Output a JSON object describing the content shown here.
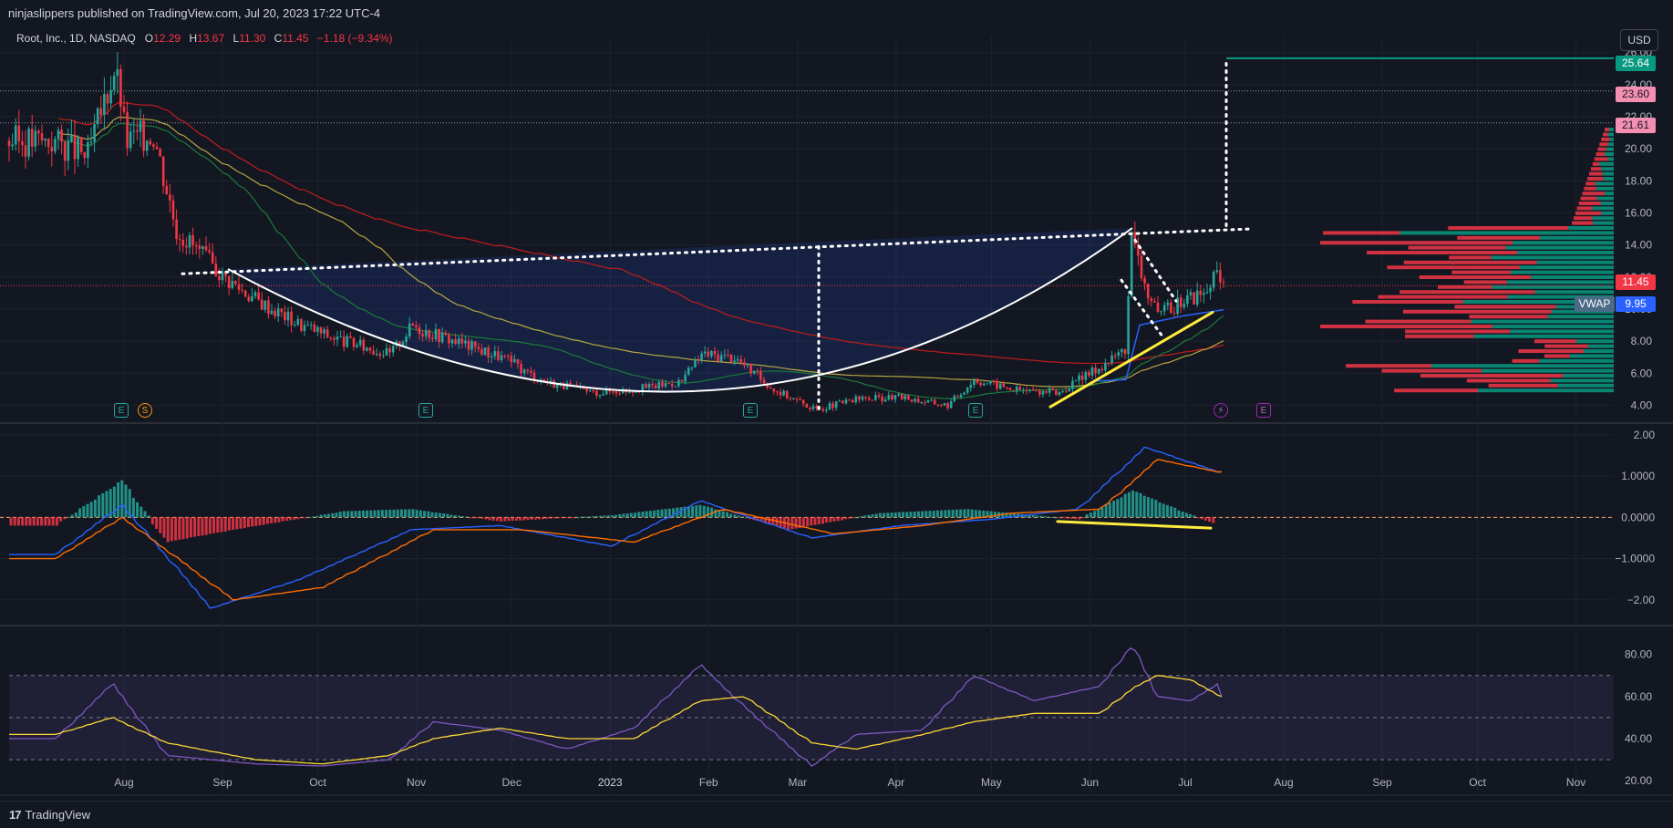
{
  "header": {
    "published": "ninjaslippers published on TradingView.com, Jul 20, 2023 17:22 UTC-4"
  },
  "legend": {
    "symbol": "Root, Inc., 1D, NASDAQ",
    "o_label": "O",
    "o": "12.29",
    "h_label": "H",
    "h": "13.67",
    "l_label": "L",
    "l": "11.30",
    "c_label": "C",
    "c": "11.45",
    "change": "−1.18 (−9.34%)"
  },
  "currency": "USD",
  "colors": {
    "bg": "#131722",
    "up": "#26a69a",
    "down": "#f23645",
    "grid": "#1e222d",
    "accent_green": "#089981",
    "pink": "#f7525f"
  },
  "price_tags": [
    {
      "label": "25.64",
      "color": "#089981"
    },
    {
      "label": "23.60",
      "color": "#f48fb1"
    },
    {
      "label": "21.61",
      "color": "#f48fb1"
    },
    {
      "label": "11.45",
      "color": "#f23645"
    },
    {
      "label": "9.95",
      "color": "#2962ff"
    }
  ],
  "vwap_label": "VWAP",
  "events": [
    "E",
    "S",
    "E",
    "E",
    "E",
    "⚡",
    "E"
  ],
  "footer": {
    "brand": "TradingView",
    "logo": "17"
  },
  "chart_data": [
    {
      "type": "line",
      "panel": "price",
      "y_axis_ticks": [
        "26.00",
        "24.00",
        "22.00",
        "20.00",
        "18.00",
        "16.00",
        "14.00",
        "12.00",
        "10.00",
        "8.00",
        "6.00",
        "4.00"
      ],
      "x_axis_ticks": [
        "Aug",
        "Sep",
        "Oct",
        "Nov",
        "Dec",
        "2023",
        "Feb",
        "Mar",
        "Apr",
        "May",
        "Jun",
        "Jul",
        "Aug",
        "Sep",
        "Oct",
        "Nov"
      ],
      "series": [
        {
          "x": [
            "2022-07-18",
            "2022-07-28",
            "2022-08-05",
            "2022-08-10",
            "2022-08-18",
            "2022-08-25",
            "2022-09-06",
            "2022-09-20",
            "2022-10-03",
            "2022-10-17",
            "2022-10-31",
            "2022-11-07",
            "2022-11-21",
            "2022-12-05",
            "2022-12-19",
            "2023-01-03",
            "2023-01-17",
            "2023-01-31",
            "2023-02-06",
            "2023-02-17",
            "2023-03-01",
            "2023-03-14",
            "2023-03-28",
            "2023-04-10",
            "2023-04-25",
            "2023-05-03",
            "2023-05-15",
            "2023-05-30",
            "2023-06-12",
            "2023-06-20",
            "2023-06-22",
            "2023-06-26",
            "2023-06-30",
            "2023-07-07",
            "2023-07-14",
            "2023-07-19",
            "2023-07-20"
          ],
          "y": [
            20.5,
            19.5,
            25.0,
            20.5,
            21.0,
            15.0,
            12.5,
            10.5,
            9.0,
            8.0,
            7.2,
            9.0,
            8.0,
            7.0,
            5.5,
            4.8,
            5.0,
            5.5,
            7.2,
            7.0,
            5.0,
            3.7,
            4.4,
            4.5,
            4.0,
            5.6,
            5.0,
            4.8,
            6.5,
            7.5,
            14.5,
            11.5,
            9.5,
            10.5,
            11.0,
            12.29,
            11.45
          ]
        }
      ]
    },
    {
      "type": "bar",
      "panel": "macd",
      "y_axis_ticks": [
        "2.00",
        "1.0000",
        "0.0000",
        "−1.0000",
        "−2.00"
      ],
      "series": [
        {
          "x": [
            "2022-07-18",
            "2022-08-08",
            "2022-08-22",
            "2022-09-12",
            "2022-10-17",
            "2022-11-07",
            "2022-12-05",
            "2023-01-09",
            "2023-02-06",
            "2023-03-06",
            "2023-04-03",
            "2023-05-01",
            "2023-06-05",
            "2023-06-22",
            "2023-07-06",
            "2023-07-19"
          ],
          "y": [
            -0.2,
            0.9,
            -0.6,
            -0.3,
            0.15,
            0.2,
            -0.1,
            0.05,
            0.3,
            -0.3,
            0.1,
            0.2,
            -0.05,
            0.65,
            0.2,
            -0.2
          ]
        },
        {
          "x": [
            "2022-07-18",
            "2022-08-08",
            "2022-09-05",
            "2022-10-03",
            "2022-11-07",
            "2022-12-05",
            "2023-01-09",
            "2023-02-06",
            "2023-03-13",
            "2023-04-10",
            "2023-05-08",
            "2023-06-05",
            "2023-06-26",
            "2023-07-19"
          ],
          "y": [
            -0.9,
            0.3,
            -2.2,
            -1.5,
            -0.3,
            -0.2,
            -0.7,
            0.4,
            -0.5,
            -0.2,
            -0.05,
            0.2,
            1.7,
            1.1
          ]
        },
        {
          "x": [
            "2022-07-18",
            "2022-08-08",
            "2022-09-12",
            "2022-10-10",
            "2022-11-14",
            "2022-12-12",
            "2023-01-16",
            "2023-02-13",
            "2023-03-20",
            "2023-04-17",
            "2023-05-15",
            "2023-06-12",
            "2023-06-30",
            "2023-07-19"
          ],
          "y": [
            -1.0,
            0.0,
            -2.0,
            -1.7,
            -0.3,
            -0.3,
            -0.6,
            0.2,
            -0.4,
            -0.2,
            0.1,
            0.2,
            1.4,
            1.1
          ]
        }
      ]
    },
    {
      "type": "line",
      "panel": "rsi",
      "y_axis_ticks": [
        "80.00",
        "60.00",
        "40.00",
        "20.00"
      ],
      "series": [
        {
          "x": [
            "2022-07-18",
            "2022-08-05",
            "2022-08-22",
            "2022-09-19",
            "2022-10-10",
            "2022-10-31",
            "2022-11-14",
            "2022-12-05",
            "2022-12-26",
            "2023-01-16",
            "2023-02-06",
            "2023-02-20",
            "2023-03-13",
            "2023-03-27",
            "2023-04-17",
            "2023-05-03",
            "2023-05-22",
            "2023-06-12",
            "2023-06-22",
            "2023-06-30",
            "2023-07-10",
            "2023-07-19",
            "2023-07-20"
          ],
          "y": [
            40,
            66,
            32,
            28,
            27,
            30,
            48,
            44,
            35,
            45,
            75,
            55,
            27,
            42,
            44,
            70,
            58,
            65,
            85,
            60,
            58,
            66,
            60
          ]
        },
        {
          "x": [
            "2022-07-18",
            "2022-08-05",
            "2022-08-22",
            "2022-09-19",
            "2022-10-10",
            "2022-10-31",
            "2022-11-14",
            "2022-12-05",
            "2022-12-26",
            "2023-01-16",
            "2023-02-06",
            "2023-02-20",
            "2023-03-13",
            "2023-03-27",
            "2023-04-17",
            "2023-05-03",
            "2023-05-22",
            "2023-06-12",
            "2023-06-22",
            "2023-06-30",
            "2023-07-10",
            "2023-07-20"
          ],
          "y": [
            42,
            50,
            38,
            30,
            28,
            32,
            40,
            45,
            40,
            40,
            58,
            60,
            38,
            35,
            42,
            48,
            52,
            52,
            64,
            70,
            68,
            60
          ]
        }
      ]
    }
  ]
}
